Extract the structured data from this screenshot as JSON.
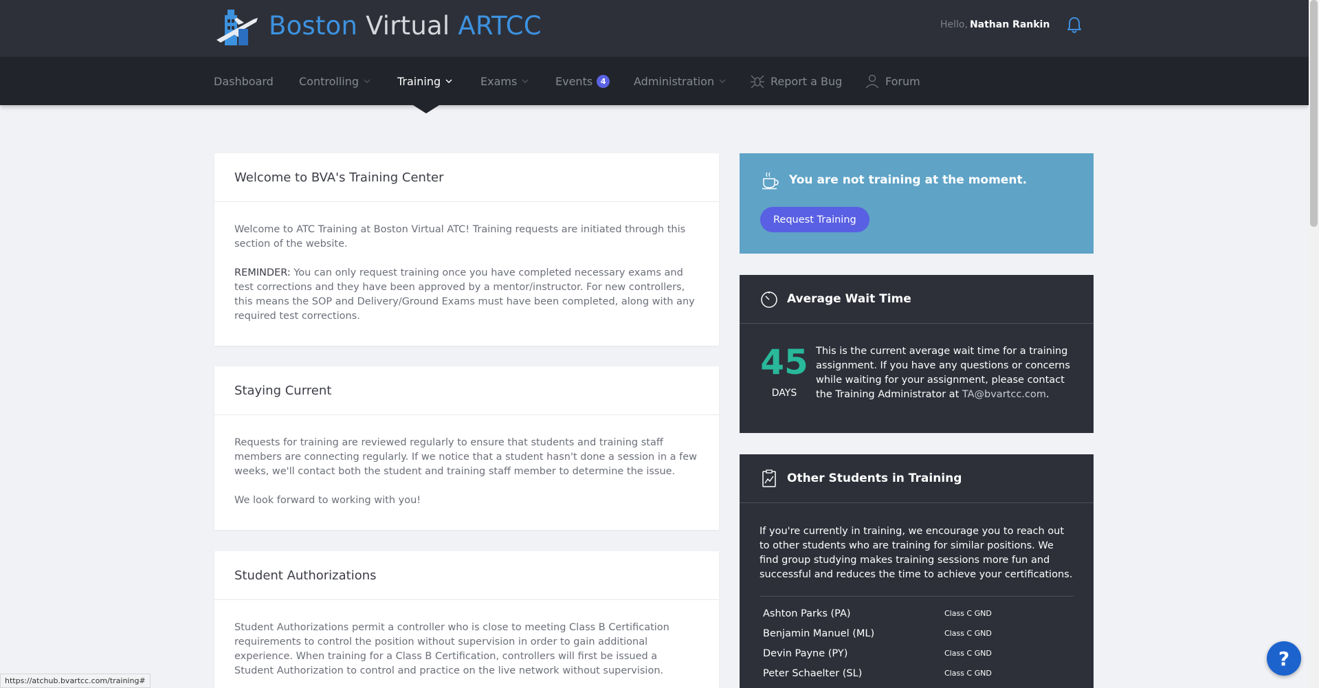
{
  "header": {
    "brand_part1": "Boston",
    "brand_part2": "Virtual",
    "brand_part3": "ARTCC",
    "greeting": "Hello,",
    "user_name": "Nathan Rankin"
  },
  "nav": {
    "items": [
      {
        "label": "Dashboard"
      },
      {
        "label": "Controlling"
      },
      {
        "label": "Training"
      },
      {
        "label": "Exams"
      },
      {
        "label": "Events",
        "badge": "4"
      },
      {
        "label": "Administration"
      },
      {
        "label": "Report a Bug"
      },
      {
        "label": "Forum"
      }
    ],
    "active": "Training"
  },
  "welcome": {
    "title": "Welcome to BVA's Training Center",
    "para1": "Welcome to ATC Training at Boston Virtual ATC! Training requests are initiated through this section of the website.",
    "reminder_label": "REMINDER:",
    "reminder_text": " You can only request training once you have completed necessary exams and test corrections and they have been approved by a mentor/instructor. For new controllers, this means the SOP and Delivery/Ground Exams must have been completed, along with any required test corrections."
  },
  "staying": {
    "title": "Staying Current",
    "para1": "Requests for training are reviewed regularly to ensure that students and training staff members are connecting regularly. If we notice that a student hasn't done a session in a few weeks, we'll contact both the student and training staff member to determine the issue.",
    "para2": "We look forward to working with you!"
  },
  "authorizations": {
    "title": "Student Authorizations",
    "para1": "Student Authorizations permit a controller who is close to meeting Class B Certification requirements to control the position without supervision in order to gain additional experience. When training for a Class B Certification, controllers will first be issued a Student Authorization to control and practice on the live network without supervision."
  },
  "status": {
    "text": "You are not training at the moment.",
    "button": "Request Training"
  },
  "wait": {
    "title": "Average Wait Time",
    "value": "45",
    "unit": "DAYS",
    "text_before": "This is the current average wait time for a training assignment. If you have any questions or concerns while waiting for your assignment, please contact the Training Administrator at ",
    "email": "TA@bvartcc.com",
    "text_after": "."
  },
  "others": {
    "title": "Other Students in Training",
    "intro": "If you're currently in training, we encourage you to reach out to other students who are training for similar positions. We find group studying makes training sessions more fun and successful and reduces the time to achieve your certifications.",
    "students": [
      {
        "name": "Ashton Parks (PA)",
        "position": "Class C GND"
      },
      {
        "name": "Benjamin Manuel (ML)",
        "position": "Class C GND"
      },
      {
        "name": "Devin Payne (PY)",
        "position": "Class C GND"
      },
      {
        "name": "Peter Schaelter (SL)",
        "position": "Class C GND"
      }
    ]
  },
  "help": {
    "label": "?"
  },
  "status_url": "https://atchub.bvartcc.com/training#",
  "colors": {
    "accent": "#5960e3",
    "brand_blue": "#3d92e0",
    "wait_green": "#29b89a",
    "status_blue": "#5fa3c7",
    "dark": "#2d3039"
  }
}
